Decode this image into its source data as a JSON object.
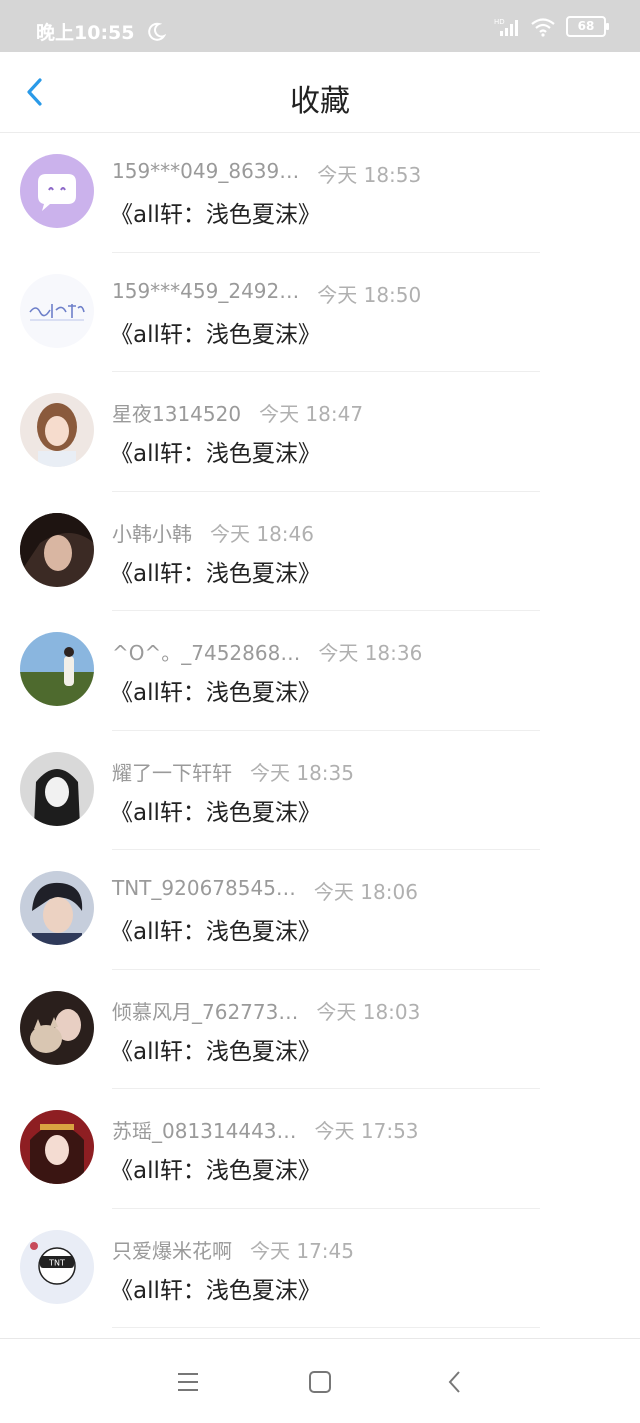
{
  "status_bar": {
    "time": "晚上10:55",
    "battery": "68"
  },
  "header": {
    "title": "收藏"
  },
  "items": [
    {
      "name": "159***049_8639…",
      "time": "今天 18:53",
      "title": "《all轩：浅色夏沫》",
      "avatar": "purple-chat-bubble"
    },
    {
      "name": "159***459_2492…",
      "time": "今天 18:50",
      "title": "《all轩：浅色夏沫》",
      "avatar": "handwriting-text"
    },
    {
      "name": "星夜1314520",
      "time": "今天 18:47",
      "title": "《all轩：浅色夏沫》",
      "avatar": "girl-portrait"
    },
    {
      "name": "小韩小韩",
      "time": "今天 18:46",
      "title": "《all轩：浅色夏沫》",
      "avatar": "dark-hair-girl"
    },
    {
      "name": "^O^。_7452868…",
      "time": "今天 18:36",
      "title": "《all轩：浅色夏沫》",
      "avatar": "outdoor-field"
    },
    {
      "name": "耀了一下轩轩",
      "time": "今天 18:35",
      "title": "《all轩：浅色夏沫》",
      "avatar": "sketch-girl"
    },
    {
      "name": "TNT_920678545…",
      "time": "今天 18:06",
      "title": "《all轩：浅色夏沫》",
      "avatar": "boy-portrait"
    },
    {
      "name": "倾慕风月_762773…",
      "time": "今天 18:03",
      "title": "《all轩：浅色夏沫》",
      "avatar": "girl-with-cat"
    },
    {
      "name": "苏瑶_081314443…",
      "time": "今天 17:53",
      "title": "《all轩：浅色夏沫》",
      "avatar": "red-costume-girl"
    },
    {
      "name": "只爱爆米花啊",
      "time": "今天 17:45",
      "title": "《all轩：浅色夏沫》",
      "avatar": "tnt-cartoon"
    }
  ]
}
